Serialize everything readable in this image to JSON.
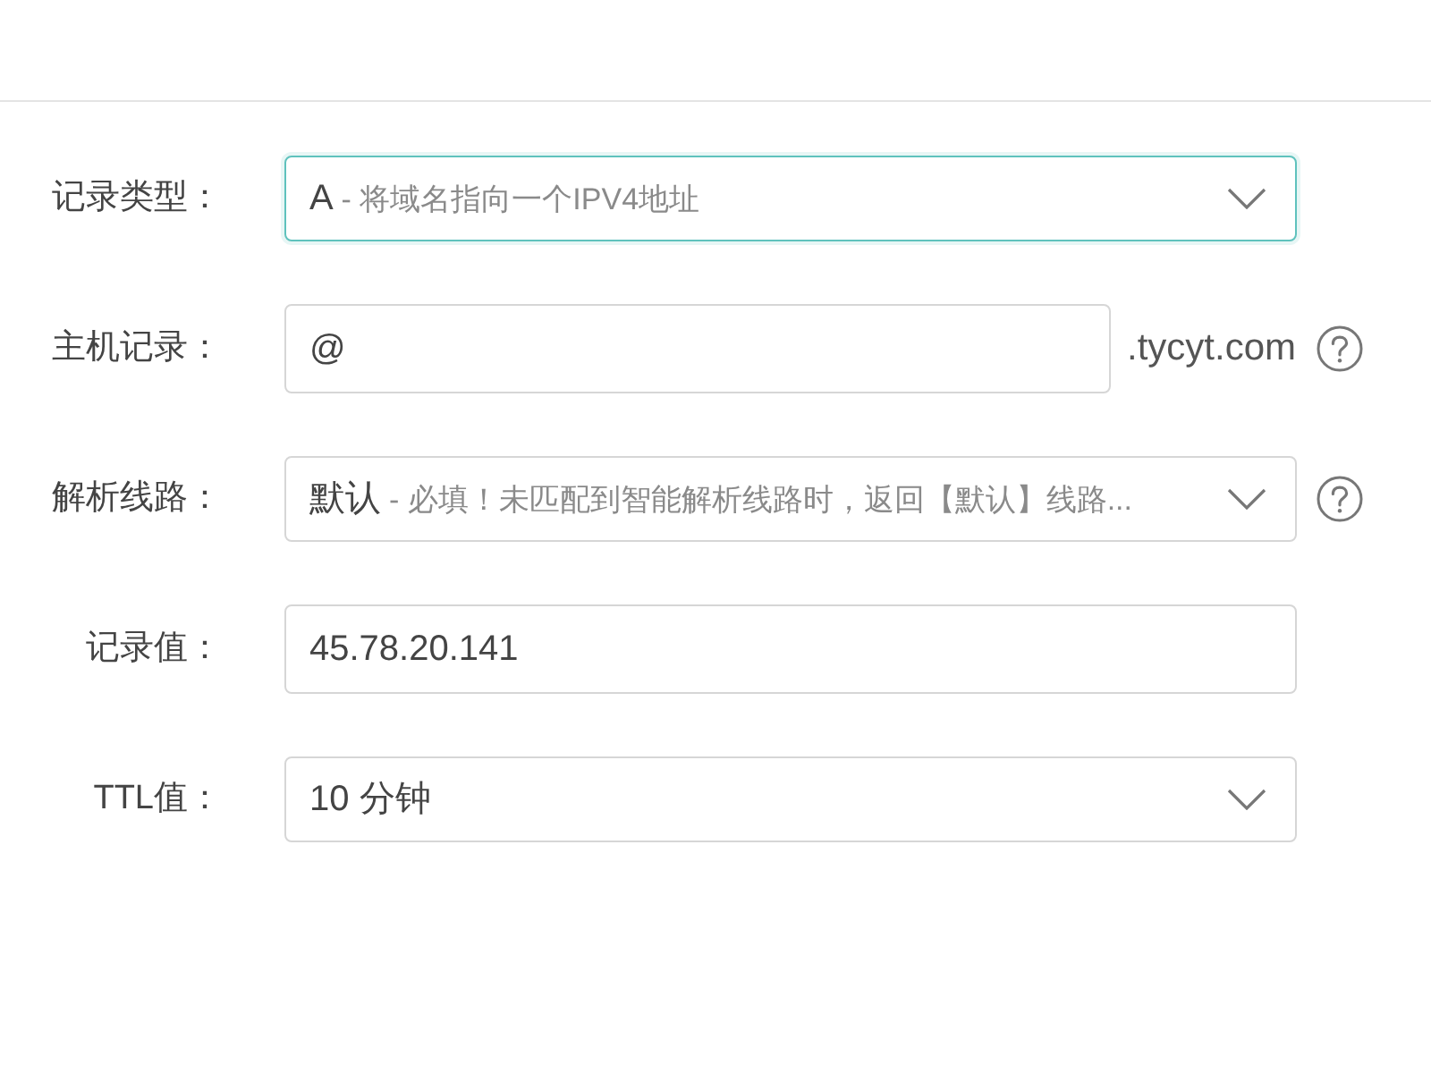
{
  "form": {
    "fields": [
      {
        "kind": "select",
        "label": "记录类型：",
        "value": "A",
        "description": "- 将域名指向一个IPV4地址",
        "focused": true,
        "help": false
      },
      {
        "kind": "input",
        "label": "主机记录：",
        "value": "@",
        "suffix": ".tycyt.com",
        "focused": false,
        "help": true
      },
      {
        "kind": "select",
        "label": "解析线路：",
        "value": "默认",
        "description": "- 必填！未匹配到智能解析线路时，返回【默认】线路...",
        "focused": false,
        "help": true
      },
      {
        "kind": "input",
        "label": "记录值：",
        "value": "45.78.20.141",
        "focused": false,
        "help": false
      },
      {
        "kind": "select",
        "label": "TTL值：",
        "value": "10 分钟",
        "focused": false,
        "help": false
      }
    ]
  }
}
